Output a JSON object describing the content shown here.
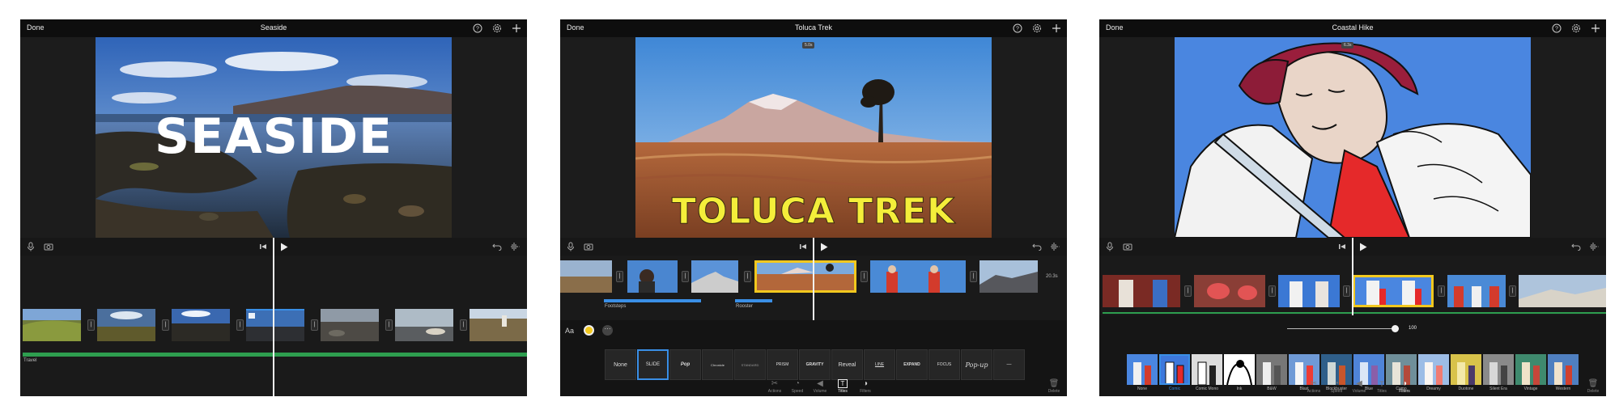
{
  "screens": [
    {
      "done_label": "Done",
      "title": "Seaside",
      "overlay_text": "SEASIDE",
      "audio_clip_label": "Travel"
    },
    {
      "done_label": "Done",
      "title": "Toluca Trek",
      "clip_duration": "5.0s",
      "overlay_text": "TOLUCA TREK",
      "audio_labels": [
        "Footsteps",
        "Rooster"
      ],
      "end_duration": "20.3s",
      "text_style_label": "Aa",
      "title_styles": [
        "None",
        "SLIDE",
        "Pop",
        "Chronicle",
        "STANDARD",
        "PRISM",
        "GRAVITY",
        "Reveal",
        "LINE",
        "EXPAND",
        "FOCUS",
        "Pop-up",
        "—"
      ],
      "selected_style": "SLIDE",
      "toolbar": [
        "Actions",
        "Speed",
        "Volume",
        "Titles",
        "Filters"
      ],
      "active_tool": "Titles",
      "delete_label": "Delete"
    },
    {
      "done_label": "Done",
      "title": "Coastal Hike",
      "clip_duration": "6.3s",
      "filter_intensity": "100",
      "filter_intensity_fraction": 1.0,
      "filters": [
        "None",
        "Comic",
        "Comic Mono",
        "Ink",
        "B&W",
        "Blast",
        "Blockbuster",
        "Blue",
        "Camo",
        "Dreamy",
        "Duotone",
        "Silent Era",
        "Vintage",
        "Western"
      ],
      "selected_filter": "Comic",
      "toolbar": [
        "Actions",
        "Speed",
        "Volume",
        "Titles",
        "Filters"
      ],
      "active_tool": "Filters",
      "delete_label": "Delete"
    }
  ],
  "colors": {
    "selection_yellow": "#f2c81e",
    "accent_blue": "#3a8fe6",
    "audio_green": "#2e9e4f",
    "title_yellow": "#f4ee3a"
  },
  "icons": [
    "help-icon",
    "settings-icon",
    "add-icon",
    "microphone-icon",
    "camera-icon",
    "skip-back-icon",
    "play-icon",
    "undo-icon",
    "audio-wave-icon",
    "trash-icon",
    "more-icon",
    "color-dot-icon"
  ]
}
